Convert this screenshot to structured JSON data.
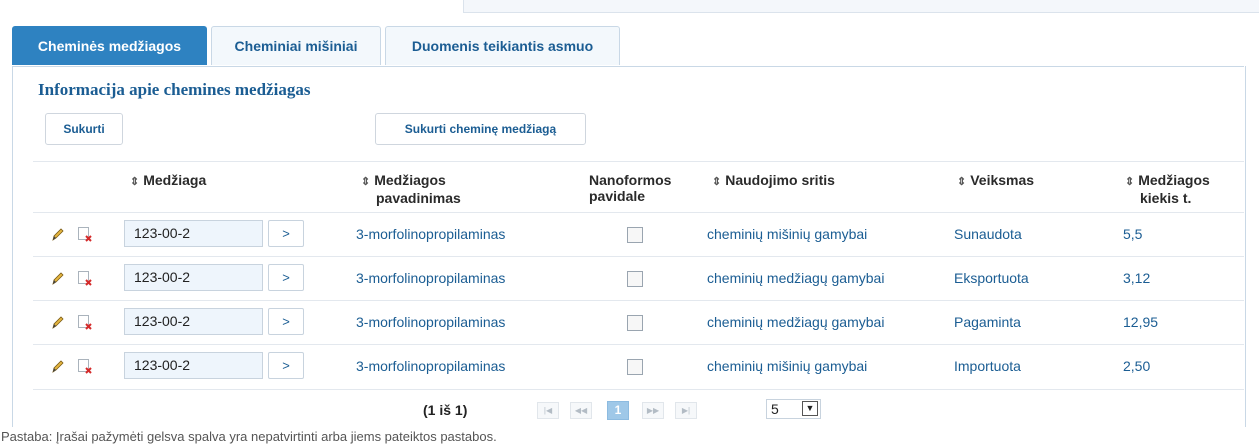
{
  "tabs": [
    "Cheminės medžiagos",
    "Cheminiai mišiniai",
    "Duomenis teikiantis asmuo"
  ],
  "section_title": "Informacija apie chemines medžiagas",
  "buttons": {
    "create": "Sukurti",
    "create_substance": "Sukurti cheminę medžiagą"
  },
  "sort_icon": "⇕",
  "columns": {
    "substance": "Medžiaga",
    "substance_name_1": "Medžiagos",
    "substance_name_2": "pavadinimas",
    "nano_1": "Nanoformos",
    "nano_2": "pavidale",
    "usage": "Naudojimo sritis",
    "action": "Veiksmas",
    "quantity_1": "Medžiagos",
    "quantity_2": "kiekis t."
  },
  "go_label": ">",
  "rows": [
    {
      "code": "123-00-2",
      "name": "3-morfolinopropilaminas",
      "usage": "cheminių mišinių gamybai",
      "action": "Sunaudota",
      "quantity": "5,5"
    },
    {
      "code": "123-00-2",
      "name": "3-morfolinopropilaminas",
      "usage": "cheminių medžiagų gamybai",
      "action": "Eksportuota",
      "quantity": "3,12"
    },
    {
      "code": "123-00-2",
      "name": "3-morfolinopropilaminas",
      "usage": "cheminių medžiagų gamybai",
      "action": "Pagaminta",
      "quantity": "12,95"
    },
    {
      "code": "123-00-2",
      "name": "3-morfolinopropilaminas",
      "usage": "cheminių mišinių gamybai",
      "action": "Importuota",
      "quantity": "2,50"
    }
  ],
  "pager": {
    "label": "(1 iš 1)",
    "first": "|◀",
    "prev": "◀◀",
    "current": "1",
    "next": "▶▶",
    "last": "▶|",
    "page_size": "5"
  },
  "note": "Pastaba: Įrašai pažymėti gelsva spalva yra nepatvirtinti arba jiems pateiktos pastabos."
}
